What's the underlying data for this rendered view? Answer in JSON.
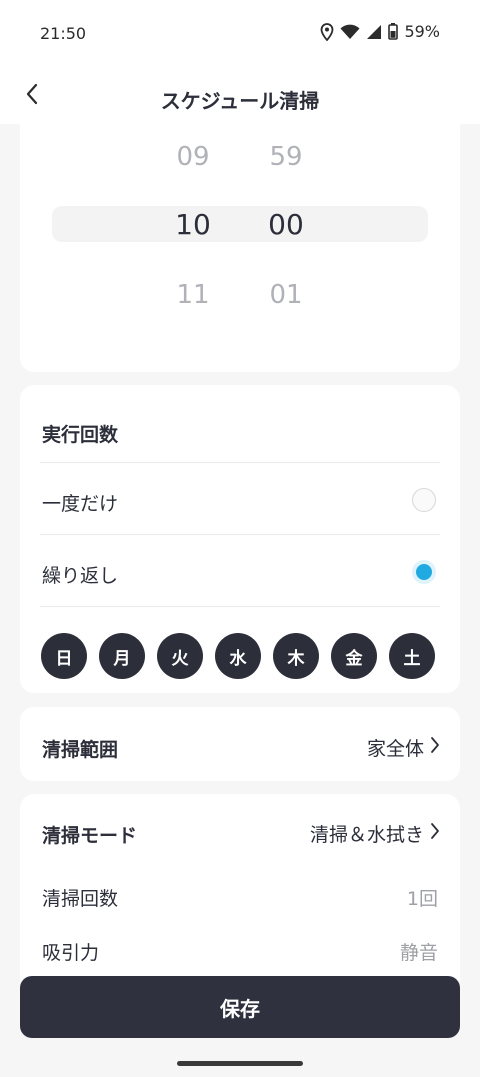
{
  "status_bar": {
    "time": "21:50",
    "battery_percent": "59%",
    "icons": [
      "location-icon",
      "wifi-icon",
      "signal-icon",
      "battery-icon"
    ]
  },
  "header": {
    "title": "スケジュール清掃",
    "back_icon": "chevron-left-icon"
  },
  "time_picker": {
    "hours": [
      "09",
      "10",
      "11"
    ],
    "minutes": [
      "59",
      "00",
      "01"
    ],
    "selected_hour": "10",
    "selected_minute": "00"
  },
  "frequency": {
    "title": "実行回数",
    "options": [
      {
        "label": "一度だけ",
        "selected": false
      },
      {
        "label": "繰り返し",
        "selected": true
      }
    ],
    "days": [
      "日",
      "月",
      "火",
      "水",
      "木",
      "金",
      "土"
    ]
  },
  "area": {
    "label": "清掃範囲",
    "value": "家全体"
  },
  "mode": {
    "label": "清掃モード",
    "value": "清掃＆水拭き",
    "details": [
      {
        "label": "清掃回数",
        "value": "1回"
      },
      {
        "label": "吸引力",
        "value": "静音"
      }
    ]
  },
  "save_label": "保存",
  "colors": {
    "accent": "#21a9e1",
    "dark": "#2c2f3a",
    "background": "#f6f6f6"
  }
}
